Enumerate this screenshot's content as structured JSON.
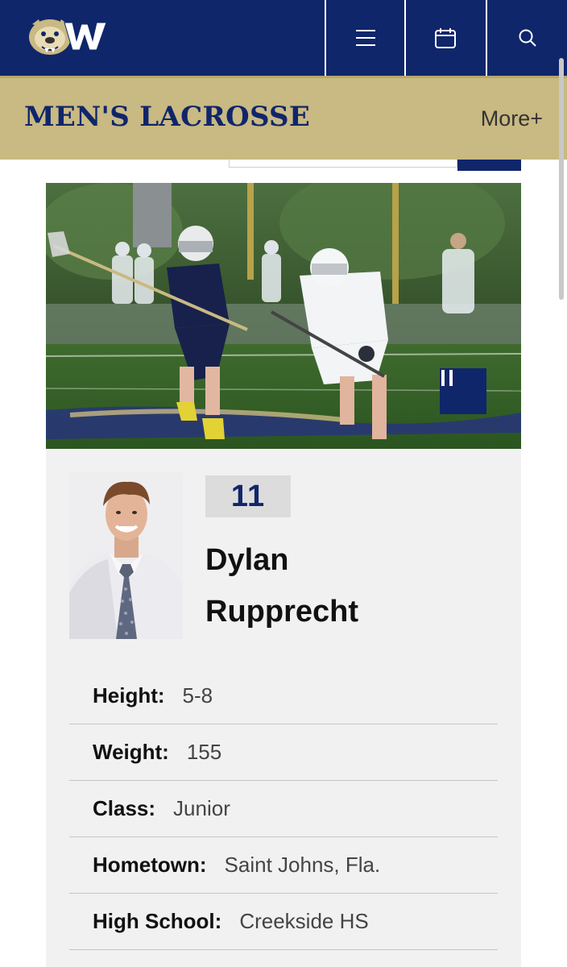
{
  "header": {
    "logo_alt": "Drew W logo",
    "icons": {
      "menu": "hamburger-menu-icon",
      "calendar": "calendar-icon",
      "search": "search-icon"
    },
    "colors": {
      "navy": "#10266b",
      "gold": "#c9b982"
    }
  },
  "sport": {
    "title": "MEN'S LACROSSE",
    "more_label": "More+"
  },
  "media": {
    "slide_control": "pause-icon"
  },
  "player": {
    "number": "11",
    "first_name": "Dylan",
    "last_name": "Rupprecht"
  },
  "details": [
    {
      "label": "Height:",
      "value": "5-8"
    },
    {
      "label": "Weight:",
      "value": "155"
    },
    {
      "label": "Class:",
      "value": "Junior"
    },
    {
      "label": "Hometown:",
      "value": "Saint Johns, Fla."
    },
    {
      "label": "High School:",
      "value": "Creekside HS"
    }
  ]
}
